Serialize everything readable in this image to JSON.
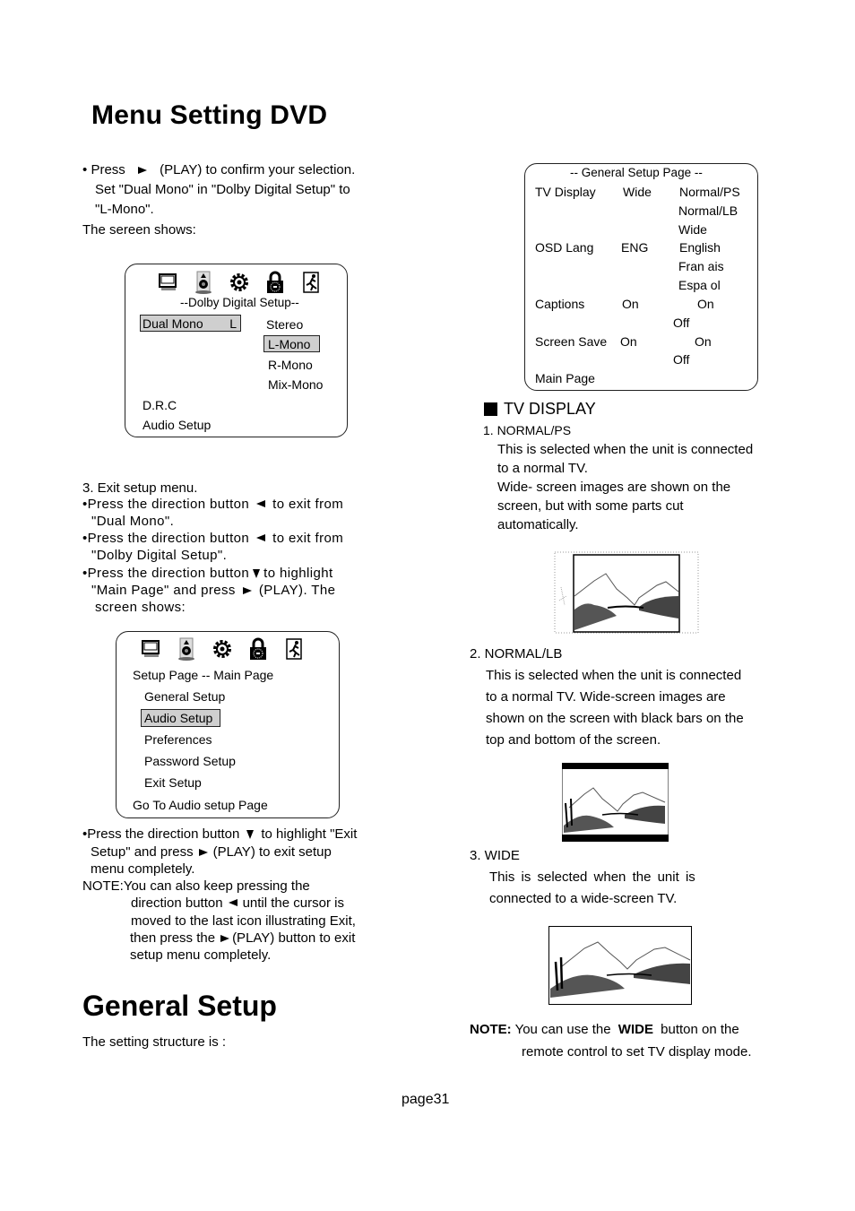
{
  "title": "Menu Setting DVD",
  "intro": {
    "line1_pre": "Press",
    "line1_post": "(PLAY) to confirm your selection.",
    "line2": "Set \"Dual Mono\" in \"Dolby Digital Setup\" to",
    "line3": "\"L-Mono\".",
    "line4": "The sereen shows:"
  },
  "dolby_screen": {
    "icons": [
      "tv-icon",
      "speaker-icon",
      "gear-icon",
      "lock-icon",
      "exit-icon"
    ],
    "heading": "--Dolby Digital Setup--",
    "item_label": "Dual Mono",
    "item_value": "L",
    "options": [
      "Stereo",
      "L-Mono",
      "R-Mono",
      "Mix-Mono"
    ],
    "selected_option": "L-Mono",
    "other_items": [
      "D.R.C"
    ],
    "footer": "Audio Setup"
  },
  "exit_steps": {
    "heading": "3. Exit setup menu.",
    "b1_pre": "Press the direction button",
    "b1_post": "to exit from",
    "b1_line2": "\"Dual Mono\".",
    "b2_pre": "Press the direction button",
    "b2_post": "to exit from",
    "b2_line2": "\"Dolby Digital Setup\".",
    "b3_pre": "Press the direction button",
    "b3_post": "to highlight",
    "b3_line2_pre": "\"Main Page\" and press",
    "b3_line2_post": "(PLAY). The",
    "b3_line3": "screen shows:"
  },
  "main_screen": {
    "icons": [
      "tv-icon",
      "speaker-icon",
      "gear-icon",
      "lock-icon",
      "exit-icon"
    ],
    "heading": "Setup Page -- Main Page",
    "items": [
      "General Setup",
      "Audio Setup",
      "Preferences",
      "Password Setup",
      "Exit Setup"
    ],
    "selected": "Audio Setup",
    "footer": "Go To Audio setup Page"
  },
  "exit_complete": {
    "l1_pre": "Press the direction button",
    "l1_post": "to highlight \"Exit",
    "l2_pre": "Setup\" and press",
    "l2_post": "(PLAY) to exit setup",
    "l3": "menu completely.",
    "note_l1": "NOTE:You can also keep pressing the",
    "note_l2_pre": "direction button",
    "note_l2_post": "until the cursor is",
    "note_l3": "moved to the last icon illustrating Exit,",
    "note_l4_pre": "then press the",
    "note_l4_post": "(PLAY) button to exit",
    "note_l5": "setup menu completely."
  },
  "general_setup": {
    "title": "General Setup",
    "subtitle": "The setting structure is :"
  },
  "general_screen": {
    "heading": "--  General Setup Page --",
    "rows": [
      {
        "label": "TV Display",
        "value": "Wide",
        "options": [
          "Normal/PS",
          "Normal/LB",
          "Wide"
        ]
      },
      {
        "label": "OSD Lang",
        "value": "ENG",
        "options": [
          "English",
          "Fran ais",
          "Espa ol"
        ]
      },
      {
        "label": "Captions",
        "value": "On",
        "options": [
          "On",
          "Off"
        ]
      },
      {
        "label": "Screen Save",
        "value": "On",
        "options": [
          "On",
          "Off"
        ]
      }
    ],
    "footer": "Main Page"
  },
  "tv_display": {
    "heading": "TV DISPLAY",
    "s1_title": "1. NORMAL/PS",
    "s1_lines": [
      "This is selected when the unit is connected",
      "to a normal TV.",
      "Wide- screen images are shown on the",
      "screen, but   with some parts cut",
      "automatically."
    ],
    "s2_title": "2.   NORMAL/LB",
    "s2_lines": [
      "This is selected when the unit is connected",
      "to a normal TV. Wide-screen images are",
      "shown on the screen with black bars on the",
      "top and bottom of the screen."
    ],
    "s3_title": "3.   WIDE",
    "s3_lines": [
      "This  is  selected  when  the  unit  is",
      "connected to a wide-screen TV."
    ],
    "note_label": "NOTE:",
    "note_pre": "You can use the",
    "note_bold": "WIDE",
    "note_post": "button on the",
    "note_l2": "remote control to set TV display mode."
  },
  "footer": {
    "page": "page31"
  }
}
